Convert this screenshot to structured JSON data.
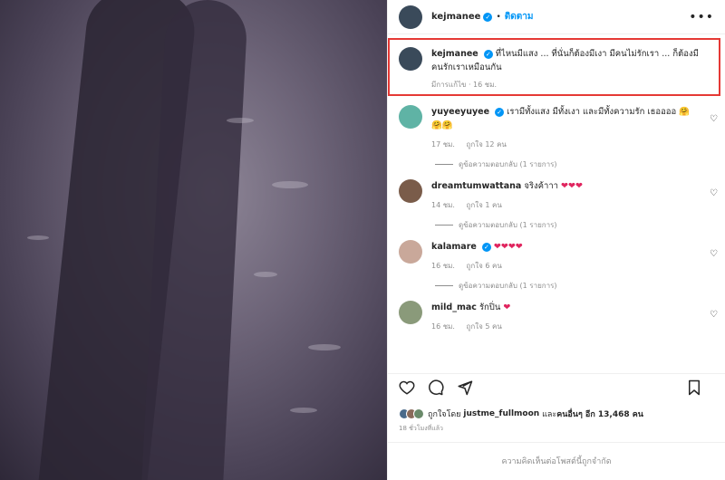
{
  "header": {
    "username": "kejmanee",
    "follow_label": "ติดตาม",
    "more_label": "•••"
  },
  "caption": {
    "username": "kejmanee",
    "text": "ที่ไหนมีแสง ... ที่นั่นก็ต้องมีเงา มีคนไม่รักเรา ... ก็ต้องมีคนรักเราเหมือนกัน",
    "edited": "มีการแก้ไข",
    "time": "16 ชม."
  },
  "comments": [
    {
      "username": "yuyeeyuyee",
      "verified": true,
      "text": "เรามีทั้งแสง มีทั้งเงา และมีทั้งความรัก เธออออ 🤗🤗🤗",
      "time": "17 ชม.",
      "likes": "ถูกใจ 12 คน",
      "replies": "ดูข้อความตอบกลับ (1 รายการ)"
    },
    {
      "username": "dreamtumwattana",
      "verified": false,
      "text": "จริงค้าาา",
      "hearts": "❤❤❤",
      "time": "14 ชม.",
      "likes": "ถูกใจ 1 คน",
      "replies": "ดูข้อความตอบกลับ (1 รายการ)"
    },
    {
      "username": "kalamare",
      "verified": true,
      "text": "",
      "hearts": "❤❤❤❤",
      "time": "16 ชม.",
      "likes": "ถูกใจ 6 คน",
      "replies": "ดูข้อความตอบกลับ (1 รายการ)"
    },
    {
      "username": "mild_mac",
      "verified": false,
      "text": "รักปิ่น",
      "hearts": "❤",
      "time": "16 ชม.",
      "likes": "ถูกใจ 5 คน"
    }
  ],
  "likes": {
    "prefix": "ถูกใจโดย",
    "first_user": "justme_fullmoon",
    "and": "และ",
    "others_label": "คนอื่นๆ อีก 13,468 คน"
  },
  "posted_ago": "18 ชั่วโมงที่แล้ว",
  "comments_closed": "ความคิดเห็นต่อโพสต์นี้ถูกจำกัด",
  "colors": {
    "accent": "#0095f6",
    "highlight": "#e53935",
    "heart": "#e0245e"
  }
}
